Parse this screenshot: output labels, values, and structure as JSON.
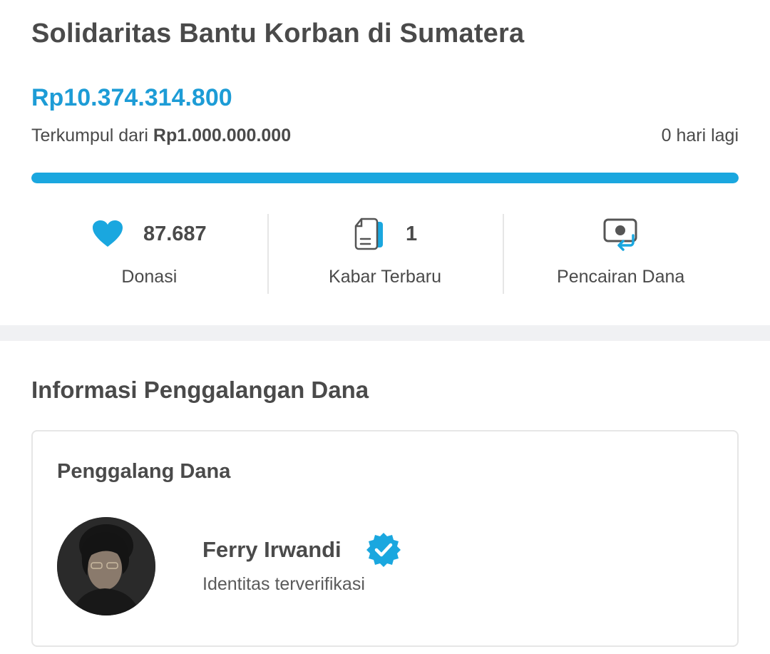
{
  "campaign": {
    "title": "Solidaritas Bantu Korban di Sumatera",
    "amount_collected": "Rp10.374.314.800",
    "target_prefix": "Terkumpul dari",
    "target_amount": "Rp1.000.000.000",
    "days_left": "0 hari lagi",
    "progress_percent": 100
  },
  "stats": [
    {
      "icon": "heart-icon",
      "count": "87.687",
      "label": "Donasi"
    },
    {
      "icon": "document-icon",
      "count": "1",
      "label": "Kabar Terbaru"
    },
    {
      "icon": "withdraw-icon",
      "count": "",
      "label": "Pencairan Dana"
    }
  ],
  "info": {
    "section_title": "Informasi Penggalangan Dana",
    "card_title": "Penggalang Dana",
    "fundraiser_name": "Ferry Irwandi",
    "fundraiser_status": "Identitas terverifikasi",
    "verified_icon": "verified-badge-icon"
  },
  "colors": {
    "accent": "#1d9cd6",
    "progress": "#1aa7df",
    "text": "#4a4a4a",
    "band": "#f0f1f3"
  }
}
